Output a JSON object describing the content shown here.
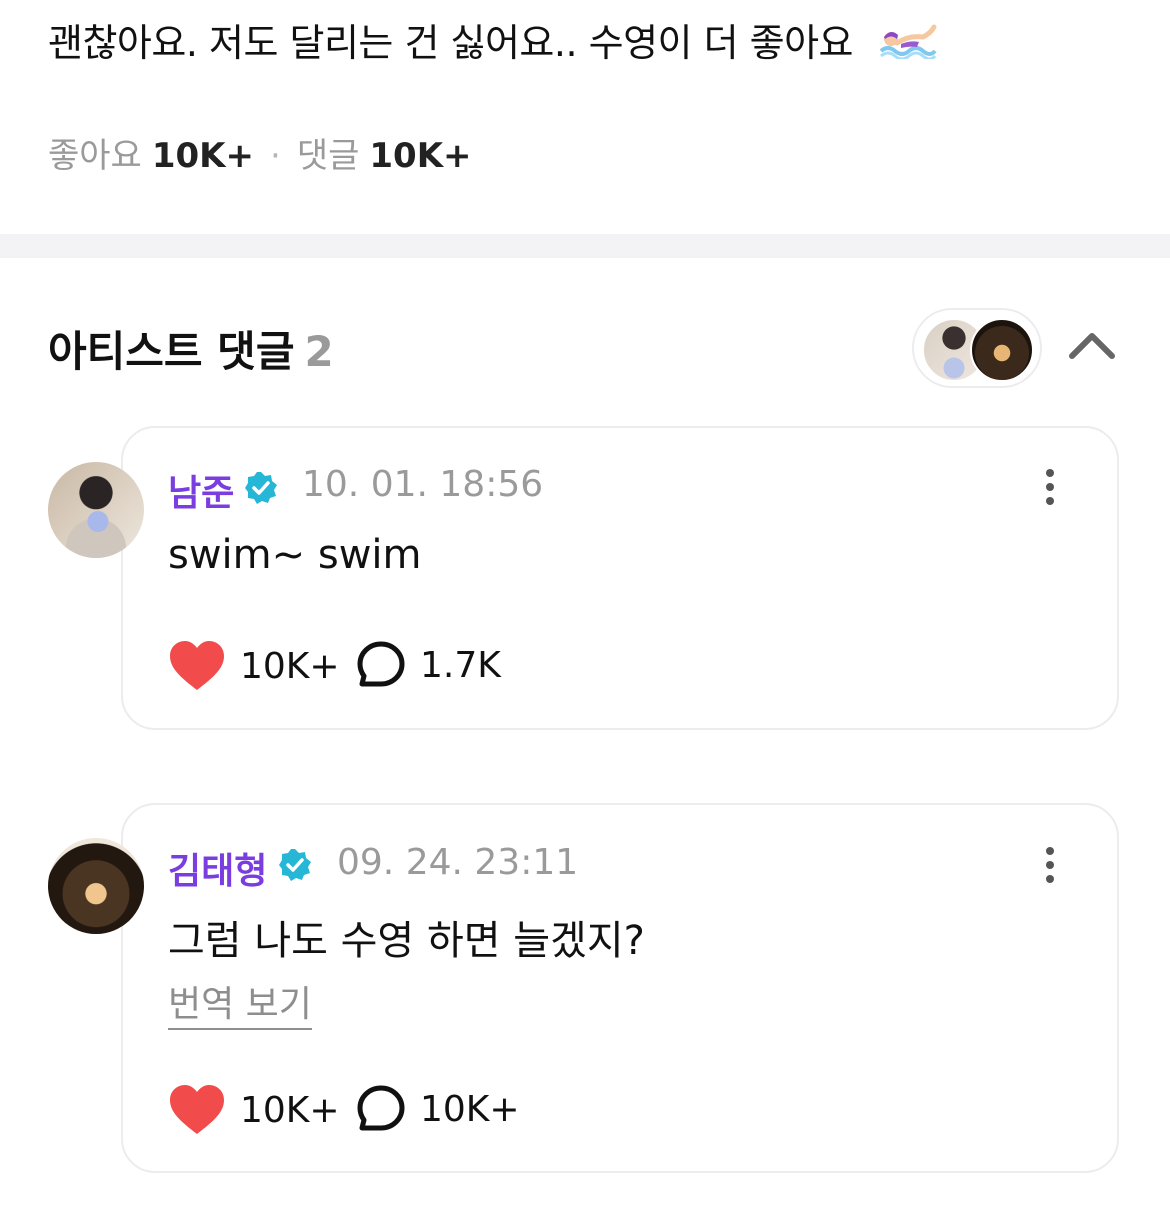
{
  "post": {
    "text": "괜찮아요. 저도 달리는 건 싫어요.. 수영이 더 좋아요"
  },
  "stats": {
    "likes_label": "좋아요",
    "likes_count": "10K+",
    "comments_label": "댓글",
    "comments_count": "10K+"
  },
  "artist_comments": {
    "title": "아티스트 댓글",
    "count": "2",
    "collapse_icon": "chevron-up-icon"
  },
  "comments": [
    {
      "author": "남준",
      "verified": true,
      "timestamp": "10. 01. 18:56",
      "text": "swim~ swim",
      "likes": "10K+",
      "replies": "1.7K"
    },
    {
      "author": "김태형",
      "verified": true,
      "timestamp": "09. 24. 23:11",
      "text": "그럼 나도 수영 하면 늘겠지?",
      "translate_label": "번역 보기",
      "likes": "10K+",
      "replies": "10K+"
    }
  ],
  "colors": {
    "author": "#7a3de0",
    "verified_badge": "#27b7d6",
    "heart": "#f24b4b",
    "muted": "#9a9a9a",
    "divider": "#f3f3f5"
  }
}
